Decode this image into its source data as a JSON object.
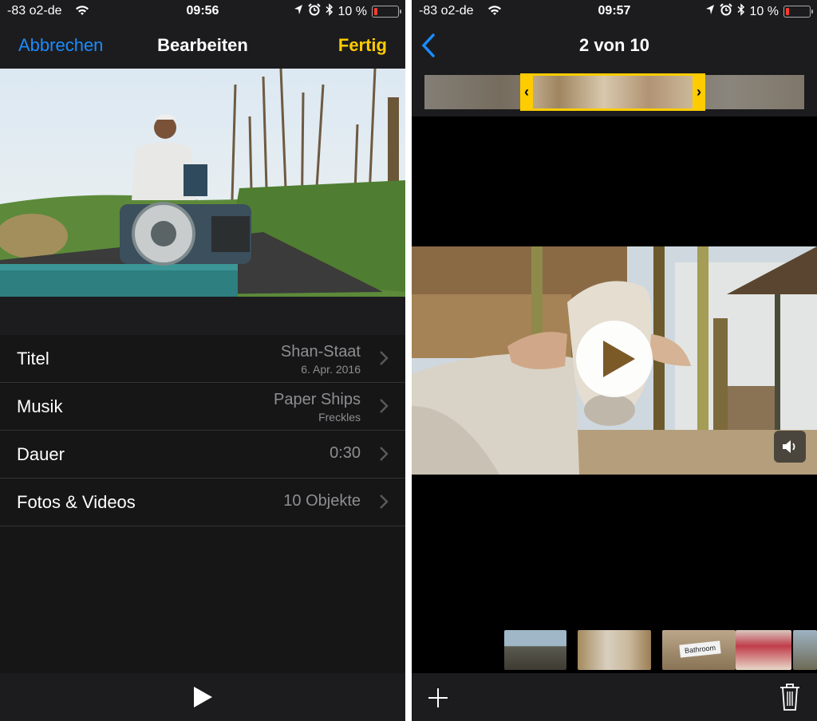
{
  "left": {
    "status": {
      "carrier": "-83 o2-de",
      "time": "09:56",
      "battery": "10 %"
    },
    "nav": {
      "cancel_label": "Abbrechen",
      "title": "Bearbeiten",
      "done_label": "Fertig"
    },
    "settings": [
      {
        "label": "Titel",
        "value": "Shan-Staat",
        "sub": "6. Apr. 2016"
      },
      {
        "label": "Musik",
        "value": "Paper Ships",
        "sub": "Freckles"
      },
      {
        "label": "Dauer",
        "value": "0:30"
      },
      {
        "label": "Fotos & Videos",
        "value": "10 Objekte"
      }
    ]
  },
  "right": {
    "status": {
      "carrier": "-83 o2-de",
      "time": "09:57",
      "battery": "10 %"
    },
    "nav": {
      "title": "2 von 10"
    },
    "thumb_label": "Bathroom"
  },
  "icons": {
    "wifi": "wifi-icon",
    "location": "location-arrow-icon",
    "alarm": "alarm-icon",
    "bluetooth": "bluetooth-icon",
    "back": "chevron-left-icon",
    "chevron": "chevron-right-icon",
    "play": "play-icon",
    "volume": "speaker-icon",
    "add": "plus-icon",
    "trash": "trash-icon"
  },
  "colors": {
    "accent_blue": "#1a8cff",
    "accent_yellow": "#ffcc00",
    "battery_low": "#ff3b30"
  }
}
